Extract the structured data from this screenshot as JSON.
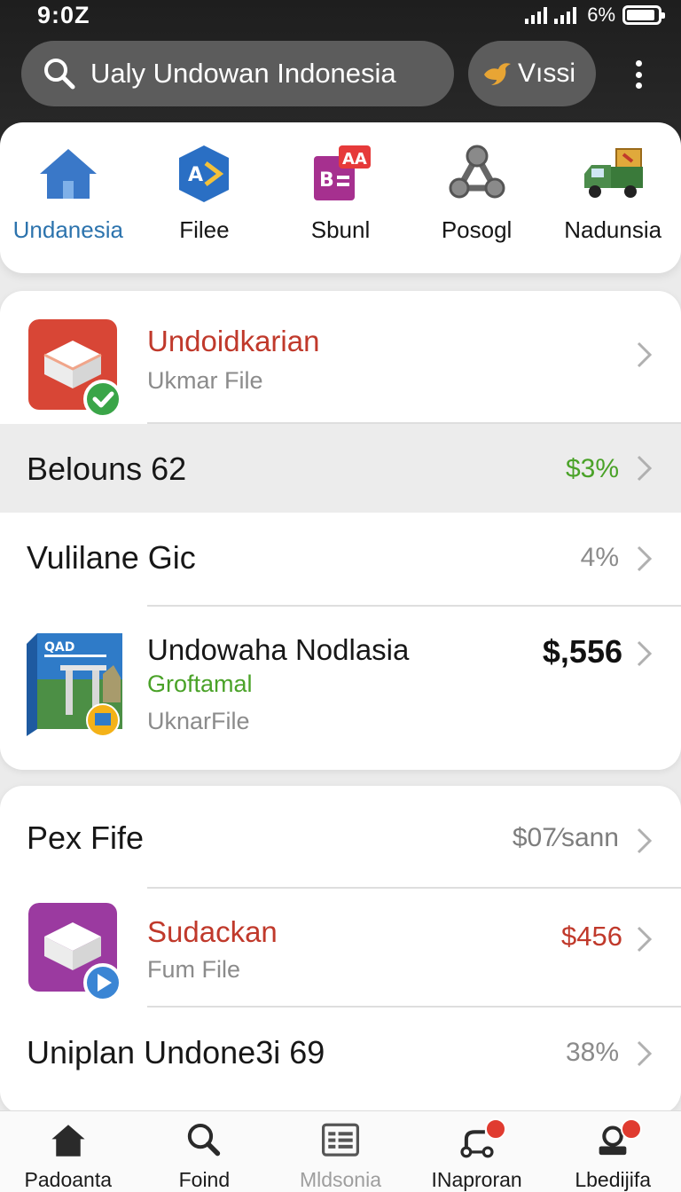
{
  "status_bar": {
    "time": "9:0Z",
    "battery": "6%"
  },
  "search": {
    "text": "Ualy Undowan Indonesia"
  },
  "header_button": {
    "label": "Vıssi"
  },
  "categories": [
    {
      "label": "Undanesia",
      "icon": "home-icon",
      "active": true
    },
    {
      "label": "Filee",
      "icon": "file-app-icon"
    },
    {
      "label": "Sbunl",
      "icon": "document-app-icon"
    },
    {
      "label": "Posogl",
      "icon": "share-node-icon"
    },
    {
      "label": "Nadunsia",
      "icon": "truck-icon"
    }
  ],
  "card1": {
    "app_row": {
      "title": "Undoidkarian",
      "subtitle": "Ukmar File",
      "icon": "red-box-icon",
      "title_color": "#c0392b"
    },
    "row_belouns": {
      "label": "Belouns 62",
      "value": "$3%",
      "value_color": "#4aa228"
    },
    "row_vulilane": {
      "label": "Vulilane Gic",
      "value": "4%"
    },
    "product_row": {
      "title": "Undowaha Nodlasia",
      "tag": "Groftamal",
      "subtitle": "UknarFile",
      "price": "$,556",
      "box_label": "QAD",
      "tag_color": "#4aa228"
    }
  },
  "card2": {
    "row_pex": {
      "label": "Pex Fife",
      "value": "$07∕sann"
    },
    "app_row": {
      "title": "Sudackan",
      "subtitle": "Fum File",
      "price": "$456",
      "icon": "purple-box-icon",
      "title_color": "#c0392b"
    },
    "row_uniplan": {
      "label": "Uniplan Undone3i 69",
      "value": "38%"
    }
  },
  "bottom_nav": [
    {
      "label": "Padoanta",
      "icon": "home-icon"
    },
    {
      "label": "Foind",
      "icon": "search-icon"
    },
    {
      "label": "Mldsonia",
      "icon": "list-icon",
      "dim": true
    },
    {
      "label": "INaproran",
      "icon": "route-icon",
      "badge": true
    },
    {
      "label": "Lbedijifa",
      "icon": "profile-icon",
      "badge": true
    }
  ]
}
